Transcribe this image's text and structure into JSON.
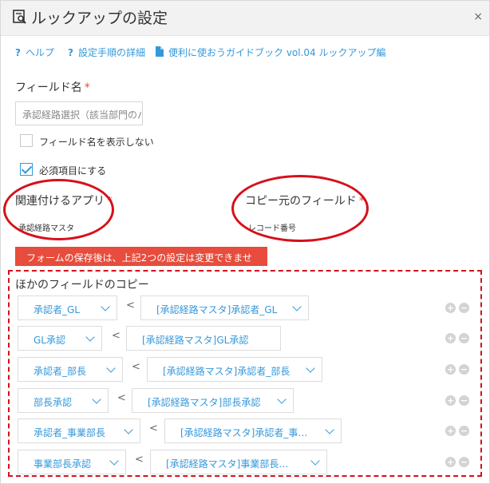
{
  "header": {
    "title": "ルックアップの設定",
    "close_label": "×"
  },
  "help": [
    {
      "icon": "question-icon",
      "label": "ヘルプ"
    },
    {
      "icon": "question-icon",
      "label": "設定手順の詳細"
    },
    {
      "icon": "document-icon",
      "label": "便利に使おうガイドブック vol.04 ルックアップ編"
    }
  ],
  "field_name": {
    "label": "フィールド名",
    "required_mark": "*",
    "value": "承認経路選択（該当部門のパ"
  },
  "options": {
    "hide_name": {
      "label": "フィールド名を表示しない",
      "checked": false
    },
    "required": {
      "label": "必須項目にする",
      "checked": true
    }
  },
  "related_app": {
    "label": "関連付けるアプリ",
    "required_mark": "*",
    "value": "承認経路マスタ"
  },
  "copy_source": {
    "label": "コピー元のフィールド",
    "required_mark": "*",
    "value": "レコード番号"
  },
  "warning": "フォームの保存後は、上記2つの設定は変更できません。",
  "copy": {
    "title": "ほかのフィールドのコピー",
    "separator": "<",
    "add_label": "+",
    "remove_label": "−",
    "rows": [
      {
        "dest": "承認者_GL",
        "src": "[承認経路マスタ]承認者_GL"
      },
      {
        "dest": "GL承認",
        "src": "[承認経路マスタ]GL承認"
      },
      {
        "dest": "承認者_部長",
        "src": "[承認経路マスタ]承認者_部長"
      },
      {
        "dest": "部長承認",
        "src": "[承認経路マスタ]部長承認"
      },
      {
        "dest": "承認者_事業部長",
        "src": "[承認経路マスタ]承認者_事…"
      },
      {
        "dest": "事業部長承認",
        "src": "[承認経路マスタ]事業部長…"
      }
    ]
  },
  "colors": {
    "accent": "#3498db",
    "required": "#e74c3c",
    "annotation": "#d6101a"
  }
}
